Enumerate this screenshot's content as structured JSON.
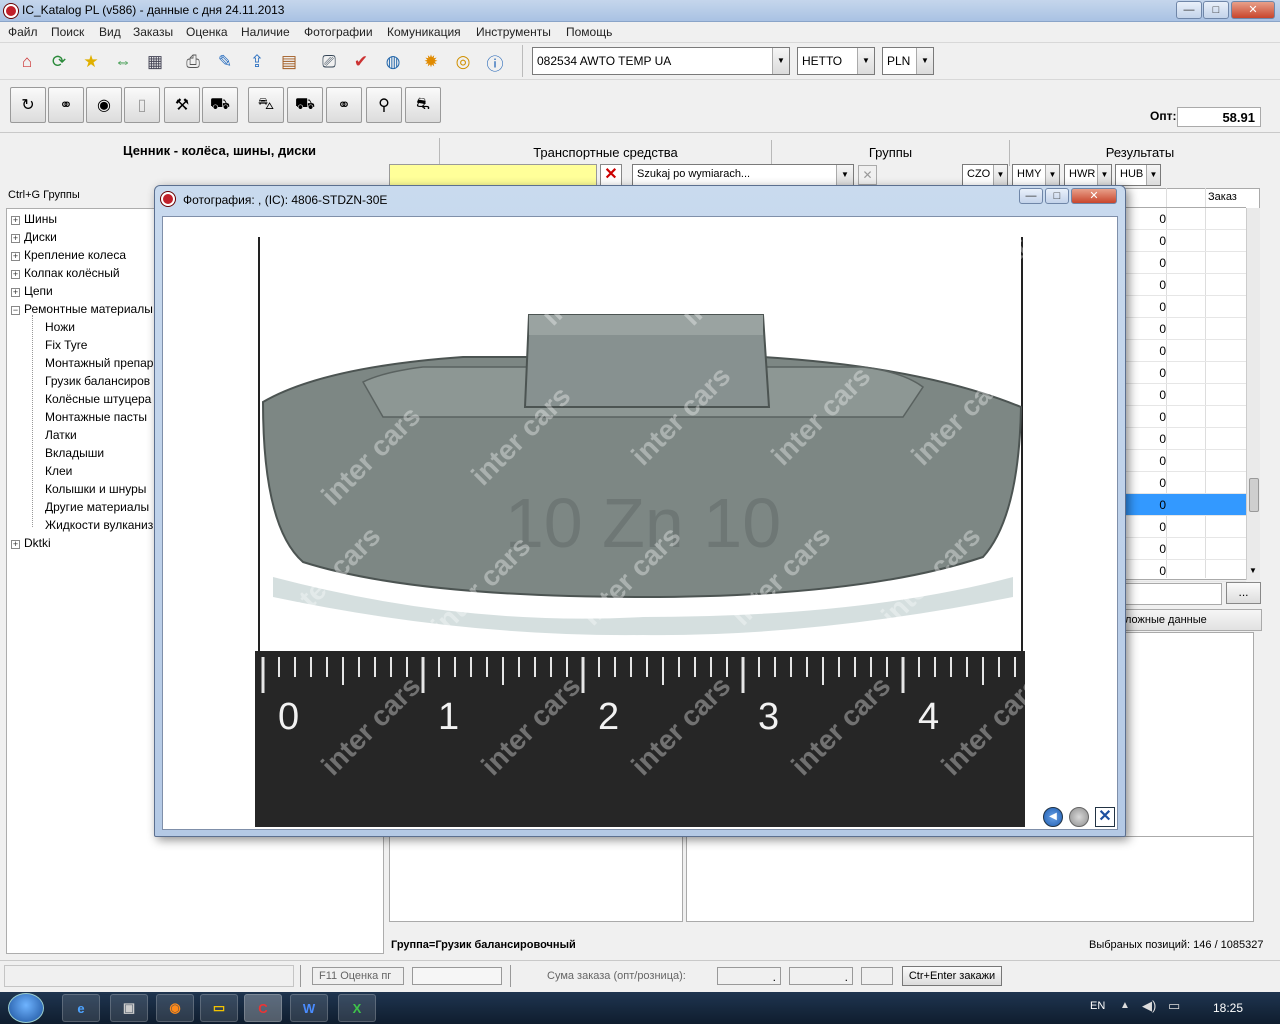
{
  "window": {
    "title": "IC_Katalog PL (v586) - данные с дня 24.11.2013",
    "min_label": "—",
    "max_label": "□",
    "close_label": "✕"
  },
  "menu": [
    "Файл",
    "Поиск",
    "Вид",
    "Заказы",
    "Оценка",
    "Наличие",
    "Фотографии",
    "Комуникация",
    "Инструменты",
    "Помощь"
  ],
  "toolbar": {
    "customer": "082534  AWTO TEMP UA",
    "price_type": "НЕТТО",
    "currency": "PLN",
    "opt_label": "Опт:",
    "opt_value": "58.91"
  },
  "headers": {
    "pricelist": "Ценник - колёса, шины, диски",
    "vehicles": "Транспортные средства",
    "groups": "Группы",
    "results": "Результаты"
  },
  "filter": {
    "search_placeholder": "Szukaj po wymiarach...",
    "buttons": [
      "CZO",
      "HMY",
      "HWR",
      "HUB"
    ]
  },
  "tree": {
    "hint": "Ctrl+G Группы",
    "items": [
      {
        "label": "Шины",
        "level": 0
      },
      {
        "label": "Диски",
        "level": 0
      },
      {
        "label": "Крепление колеса",
        "level": 0
      },
      {
        "label": "Колпак колёсный",
        "level": 0
      },
      {
        "label": "Цепи",
        "level": 0
      },
      {
        "label": "Ремонтные материалы",
        "level": 0
      },
      {
        "label": "Ножи",
        "level": 1
      },
      {
        "label": "Fix Tyre",
        "level": 1
      },
      {
        "label": "Монтажный препар",
        "level": 1
      },
      {
        "label": "Грузик балансиров",
        "level": 1
      },
      {
        "label": "Колёсные штуцера",
        "level": 1
      },
      {
        "label": "Монтажные пасты",
        "level": 1
      },
      {
        "label": "Латки",
        "level": 1
      },
      {
        "label": "Вкладыши",
        "level": 1
      },
      {
        "label": "Клеи",
        "level": 1
      },
      {
        "label": "Колышки и шнуры",
        "level": 1
      },
      {
        "label": "Другие материалы",
        "level": 1
      },
      {
        "label": "Жидкости вулканиз",
        "level": 1
      },
      {
        "label": "Dktki",
        "level": 0
      }
    ]
  },
  "results_grid": {
    "order_header": "Заказ",
    "values": [
      "0",
      "0",
      "0",
      "0",
      "0",
      "0",
      "0",
      "0",
      "0",
      "0",
      "0",
      "0",
      "0",
      "0",
      "0",
      "0",
      "0"
    ],
    "selected_row": 13,
    "more_button": "...",
    "extra_tab": "ложные данные"
  },
  "bottom_status": {
    "group": "Группа=Грузик балансировочный",
    "selected": "Выбраных позиций: 146 / 1085327"
  },
  "status_bar": {
    "estimate": "F11 Оценка пг",
    "order_sum": "Сума заказа (опт/розница):",
    "sum1": ".",
    "sum2": ".",
    "place_order": "Ctr+Enter закажи"
  },
  "photo_window": {
    "title": "Фотография: , (IC): 4806-STDZN-30E",
    "watermark": "inter cars",
    "imprint": "10  Zn  10",
    "ruler_labels": [
      "0",
      "1",
      "2",
      "3",
      "4"
    ]
  },
  "taskbar": {
    "lang": "EN",
    "time": "18:25"
  },
  "colors": {
    "selection": "#3399ff",
    "yellow_field": "#ffff99",
    "weight": "#7f8883"
  }
}
